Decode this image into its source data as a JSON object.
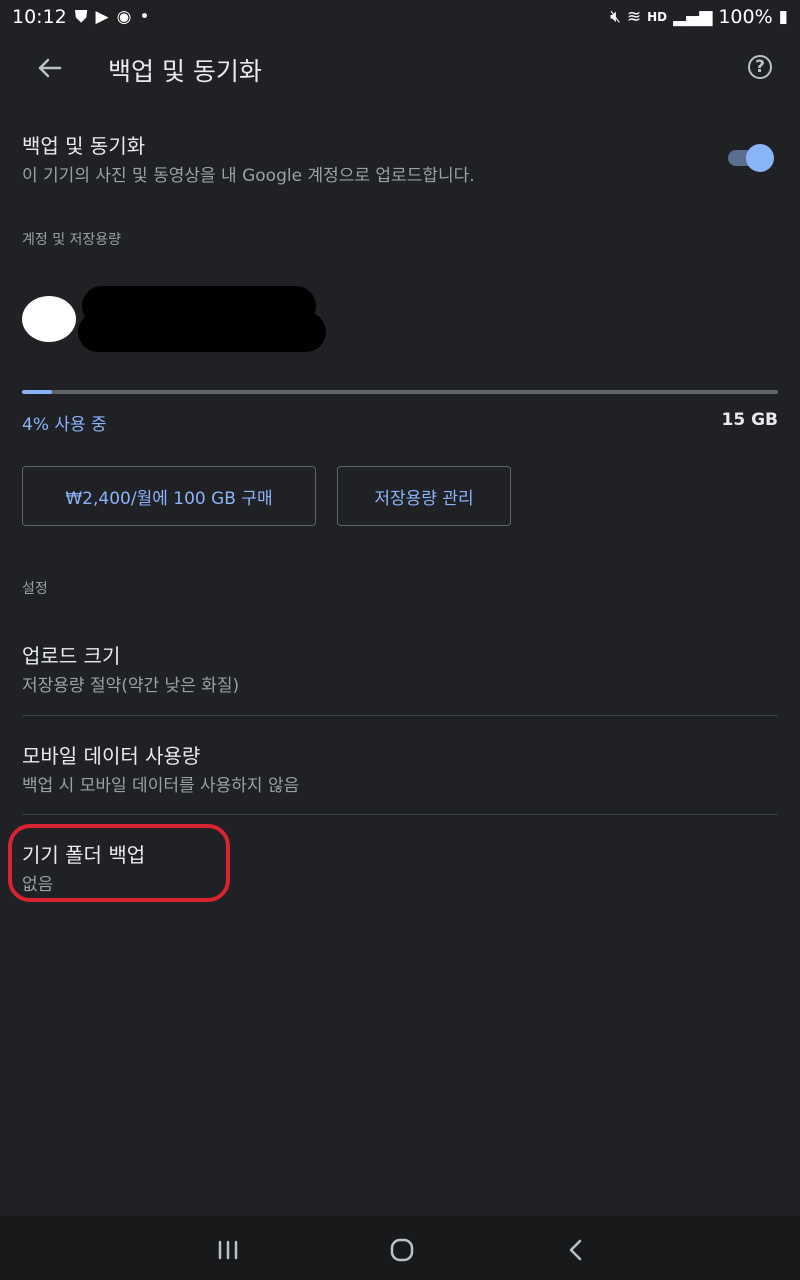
{
  "status_bar": {
    "time": "10:12",
    "hd_label": "HD",
    "battery": "100%",
    "icons": [
      "shield-icon",
      "play-store-icon",
      "pokeball-icon",
      "dot-icon",
      "mute-icon",
      "wifi-icon",
      "signal-icon",
      "battery-icon"
    ]
  },
  "app_bar": {
    "title": "백업 및 동기화"
  },
  "sync": {
    "title": "백업 및 동기화",
    "subtitle": "이 기기의 사진 및 동영상을 내 Google 계정으로 업로드합니다.",
    "enabled": true
  },
  "account_section": {
    "label": "계정 및 저장용량"
  },
  "storage": {
    "used_percent": 4,
    "usage_label": "4% 사용 중",
    "total": "15 GB"
  },
  "buttons": {
    "buy": "₩2,400/월에 100 GB 구매",
    "manage": "저장용량 관리"
  },
  "settings_section": {
    "label": "설정"
  },
  "settings": [
    {
      "title": "업로드 크기",
      "subtitle": "저장용량 절약(약간 낮은 화질)"
    },
    {
      "title": "모바일 데이터 사용량",
      "subtitle": "백업 시 모바일 데이터를 사용하지 않음"
    },
    {
      "title": "기기 폴더 백업",
      "subtitle": "없음"
    }
  ],
  "colors": {
    "background": "#202124",
    "accent": "#8ab4f8",
    "highlight": "#d9232f"
  }
}
